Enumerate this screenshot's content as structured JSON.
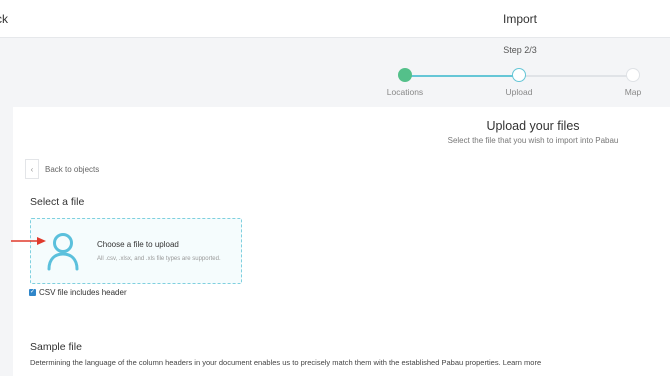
{
  "header": {
    "back_label": "ck",
    "title": "Import"
  },
  "stepper": {
    "step_text": "Step 2/3",
    "steps": [
      {
        "label": "Locations",
        "state": "completed"
      },
      {
        "label": "Upload",
        "state": "active"
      },
      {
        "label": "Map",
        "state": "pending"
      }
    ]
  },
  "upload": {
    "title": "Upload your files",
    "subtitle": "Select the file that you wish to import into Pabau",
    "back_label": "Back to objects",
    "back_icon": "chevron-left-icon",
    "select_title": "Select a file",
    "dropzone": {
      "icon": "user-icon",
      "title": "Choose a file to upload",
      "subtitle": "All .csv, .xlsx, and .xls file types are supported."
    },
    "checkbox": {
      "label": "CSV file includes header",
      "checked": true
    },
    "sample_title": "Sample file",
    "sample_desc": "Determining the language of the column headers in your document enables us to precisely match them with the established Pabau properties. Learn more"
  },
  "colors": {
    "accent": "#65c6d6",
    "completed": "#54c08a",
    "arrow": "#e03a2c",
    "checkbox": "#2f86c9"
  }
}
